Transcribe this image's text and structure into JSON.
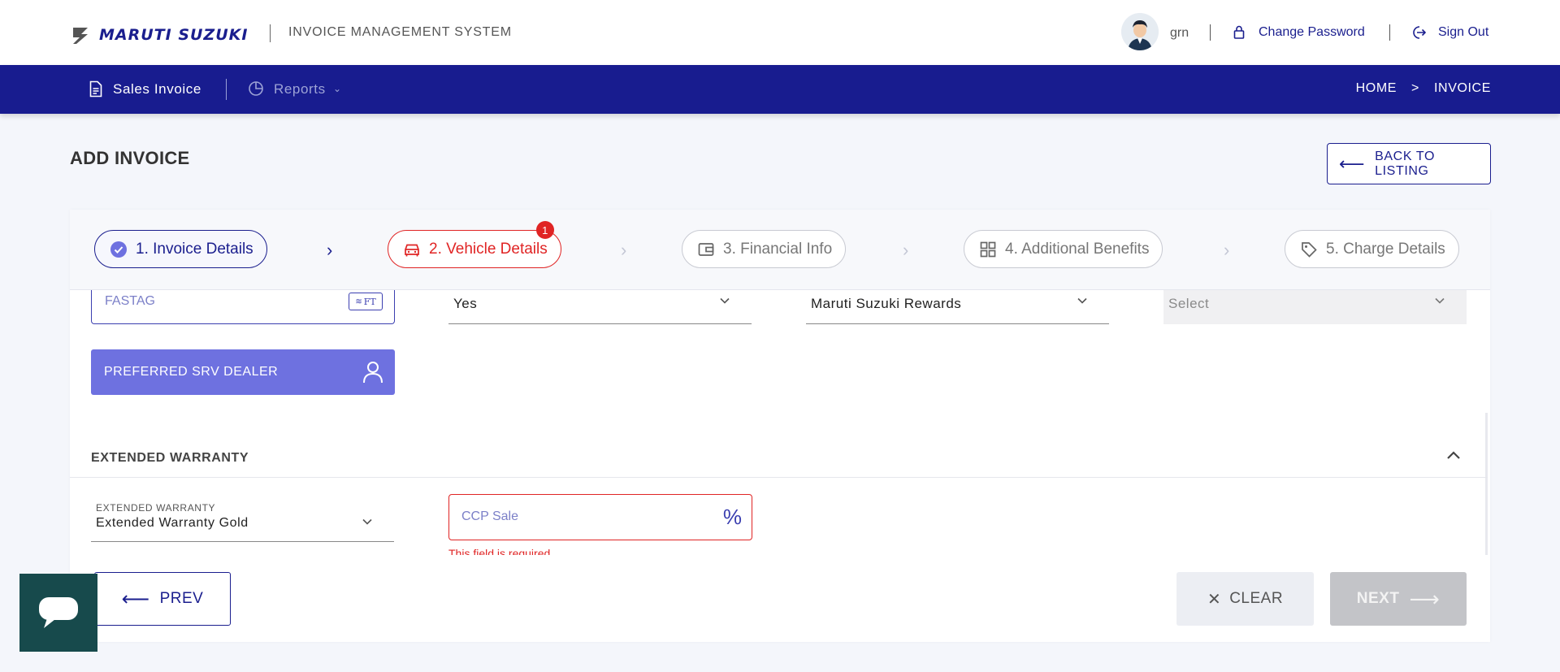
{
  "header": {
    "brand": "MARUTI SUZUKI",
    "app_name": "INVOICE MANAGEMENT SYSTEM",
    "username": "grn",
    "change_password": "Change Password",
    "sign_out": "Sign Out"
  },
  "nav": {
    "sales_invoice": "Sales Invoice",
    "reports": "Reports",
    "breadcrumb": [
      "HOME",
      ">",
      "INVOICE"
    ]
  },
  "page": {
    "title": "ADD INVOICE",
    "back_button": "BACK TO LISTING"
  },
  "steps": [
    {
      "label": "1. Invoice Details",
      "state": "done",
      "icon": "check-circle-icon"
    },
    {
      "label": "2. Vehicle Details",
      "state": "active",
      "icon": "car-icon",
      "badge": "1"
    },
    {
      "label": "3. Financial Info",
      "state": "pending",
      "icon": "wallet-icon"
    },
    {
      "label": "4. Additional Benefits",
      "state": "pending",
      "icon": "grid-icon"
    },
    {
      "label": "5. Charge Details",
      "state": "pending",
      "icon": "tag-icon"
    }
  ],
  "form": {
    "fastag_placeholder": "FASTAG",
    "fastag_icon_text": "FT",
    "dropdown_1_value": "Yes",
    "dropdown_2_value": "Maruti Suzuki Rewards",
    "dropdown_3_value": "Select",
    "preferred_srv_dealer": "PREFERRED SRV DEALER",
    "extended_warranty_section": "EXTENDED WARRANTY",
    "extended_warranty_label": "EXTENDED WARRANTY",
    "extended_warranty_value": "Extended Warranty Gold",
    "ccp_placeholder": "CCP Sale",
    "ccp_suffix": "%",
    "ccp_error": "This field is required"
  },
  "footer": {
    "prev": "PREV",
    "clear": "CLEAR",
    "next": "NEXT"
  },
  "colors": {
    "brand_navy": "#181c8f",
    "error_red": "#e02424",
    "accent_purple": "#6e71e0",
    "chat_teal": "#174a4c"
  }
}
